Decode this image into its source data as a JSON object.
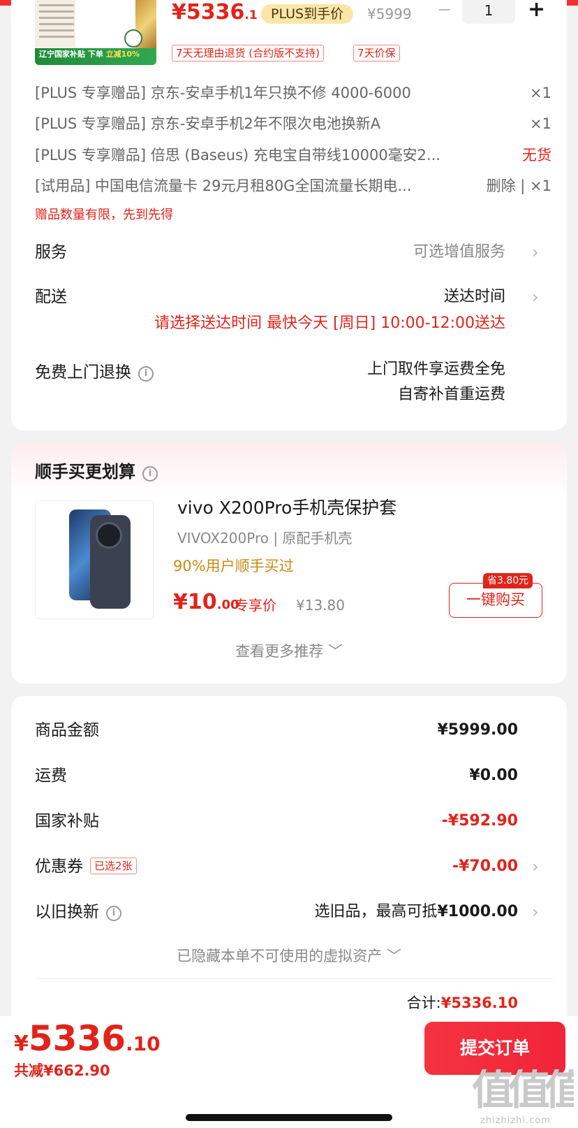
{
  "product": {
    "price_main": "¥5336",
    "price_decimal": ".1",
    "plus_tag": "PLUS到手价",
    "original_price": "¥5999",
    "qty_minus": "−",
    "quantity": "1",
    "qty_plus": "+",
    "banner_text": "辽宁国家补贴 下单",
    "banner_highlight": "立减10%",
    "badges": [
      "7天无理由退货 (合约版不支持)",
      "7天价保"
    ]
  },
  "gifts": [
    {
      "text": "[PLUS 专享赠品] 京东-安卓手机1年只换不修 4000-6000",
      "right": "×1",
      "right_red": false
    },
    {
      "text": "[PLUS 专享赠品] 京东-安卓手机2年不限次电池换新A",
      "right": "×1",
      "right_red": false
    },
    {
      "text": "[PLUS 专享赠品] 倍思 (Baseus) 充电宝自带线10000毫安2...",
      "right": "无货",
      "right_red": true
    },
    {
      "text": "[试用品] 中国电信流量卡 29元月租80G全国流量长期电...",
      "right": "删除 | ×1",
      "right_red": false
    }
  ],
  "gift_note": "赠品数量有限，先到先得",
  "service": {
    "label": "服务",
    "value": "可选增值服务"
  },
  "delivery": {
    "label": "配送",
    "value": "送达时间",
    "hint": "请选择送达时间  最快今天 [周日] 10:00-12:00送达"
  },
  "return": {
    "label": "免费上门退换",
    "line1": "上门取件享运费全免",
    "line2": "自寄补首重运费"
  },
  "addon": {
    "title": "顺手买更划算",
    "name": "vivo X200Pro手机壳保护套",
    "spec": "VIVOX200Pro | 原配手机壳",
    "buyers": "90%用户顺手买过",
    "price_int": "¥10",
    "price_dec": ".00",
    "member_label": "专享价",
    "orig_price": "¥13.80",
    "save_tag": "省3.80元",
    "buy_button": "一键购买",
    "more": "查看更多推荐 ﹀"
  },
  "summary": {
    "rows": [
      {
        "label": "商品金额",
        "value": "¥5999.00"
      },
      {
        "label": "运费",
        "value": "¥0.00"
      },
      {
        "label": "国家补贴",
        "value": "-¥592.90"
      },
      {
        "label": "优惠券",
        "value": "-¥70.00",
        "tag": "已选2张"
      },
      {
        "label": "以旧换新",
        "value_prefix": "选旧品，最高可抵",
        "value": "¥1000.00"
      }
    ],
    "hidden_note": "已隐藏本单不可使用的虚拟资产 ﹀",
    "total_label": "合计:",
    "total_value": "¥5336.10"
  },
  "footer": {
    "currency": "¥",
    "price_int": "5336",
    "price_dec": ".10",
    "saved": "共减¥662.90",
    "submit": "提交订单"
  },
  "watermark": {
    "main": "值值值",
    "sub": "zhizhizhi.com"
  },
  "colors": {
    "accent": "#e2231a",
    "plus_gold": "#fbe6a8",
    "subsidy_green": "#1e8a3a"
  }
}
